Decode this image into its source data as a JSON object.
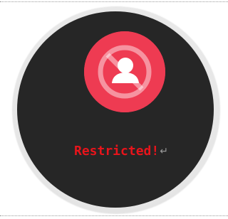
{
  "status": {
    "message": "Restricted!",
    "return_mark": "↵"
  },
  "icon": {
    "name": "restricted-user-icon",
    "circle_color": "#ee3b52",
    "glyph_color": "#ffffff"
  },
  "colors": {
    "face": "#262626",
    "message": "#e8141b"
  }
}
